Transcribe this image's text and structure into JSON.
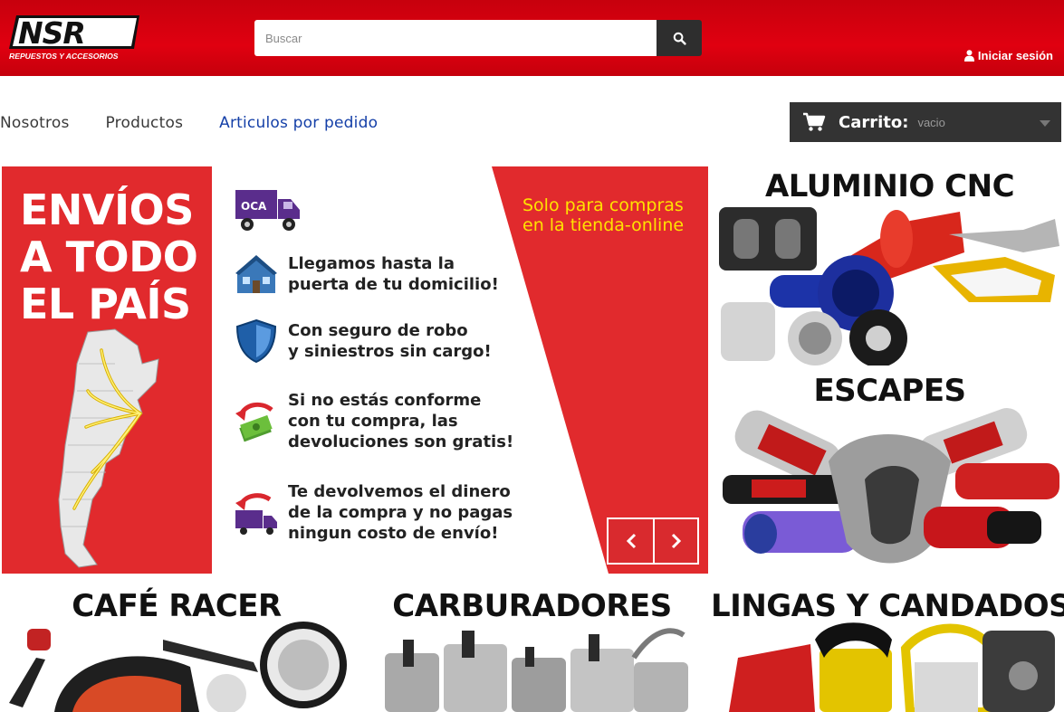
{
  "header": {
    "logo_text": "NSR",
    "logo_subtitle": "REPUESTOS Y ACCESORIOS",
    "search": {
      "placeholder": "Buscar",
      "value": ""
    },
    "search_icon": "search-icon",
    "login_label": "Iniciar sesión",
    "login_icon": "user-icon"
  },
  "nav": {
    "items": [
      {
        "label": "Nosotros"
      },
      {
        "label": "Productos"
      },
      {
        "label": "Articulos por pedido"
      }
    ]
  },
  "cart": {
    "label": "Carrito:",
    "value": "vacio",
    "icon": "cart-icon"
  },
  "slider": {
    "headline": "ENVÍOS\nA TODO\nEL PAÍS",
    "tagline": "Solo para compras\nen la tienda-online",
    "features": [
      {
        "icon": "house-icon",
        "text": "Llegamos hasta la\npuerta de tu domicilio!"
      },
      {
        "icon": "shield-icon",
        "text": "Con seguro de robo\ny siniestros sin cargo!"
      },
      {
        "icon": "money-return-icon",
        "text": "Si no estás conforme\ncon tu compra, las\ndevoluciones son gratis!"
      },
      {
        "icon": "truck-return-icon",
        "text": "Te devolvemos el dinero\nde la compra y no pagas\nningun costo de envío!"
      }
    ],
    "truck_badge": "OCA",
    "prev_icon": "chevron-left-icon",
    "next_icon": "chevron-right-icon"
  },
  "promos": {
    "aluminio": "ALUMINIO CNC",
    "escapes": "ESCAPES",
    "cafe_racer": "CAFÉ RACER",
    "carburadores": "CARBURADORES",
    "lingas": "LINGAS Y CANDADOS"
  },
  "colors": {
    "brand_red": "#e00010",
    "slider_red": "#e12a2d",
    "tagline_yellow": "#ffe200",
    "link_blue": "#1540a8",
    "cart_bg": "#333333"
  }
}
